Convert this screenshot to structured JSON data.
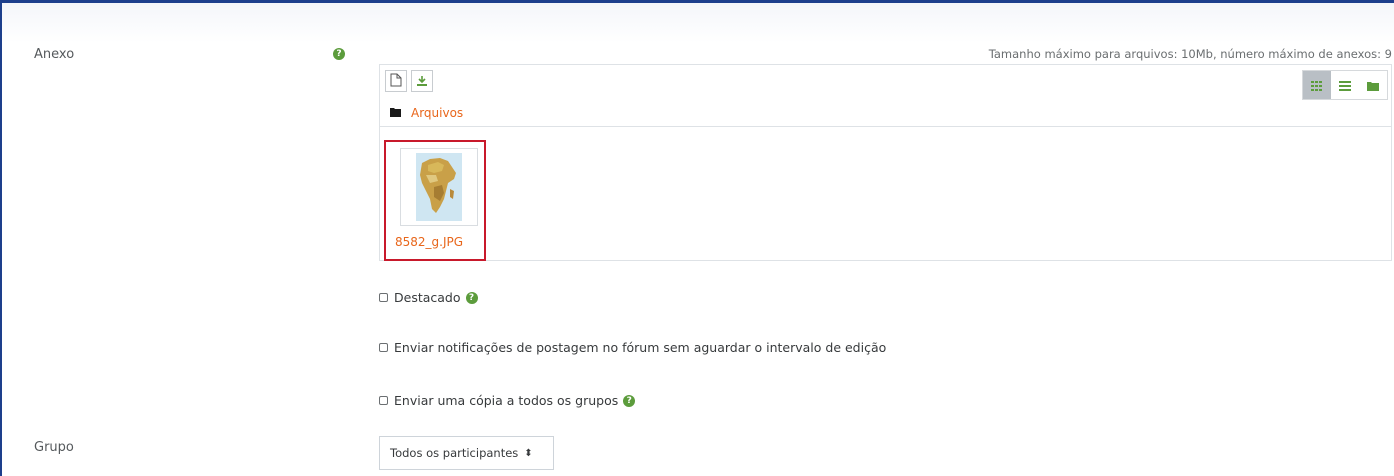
{
  "attachment": {
    "label": "Anexo",
    "max_info": "Tamanho máximo para arquivos: 10Mb, número máximo de anexos: 9",
    "toolbar": {
      "add_file_icon": "file-icon",
      "download_icon": "download-icon",
      "views": [
        "grid-view-icon",
        "list-view-icon",
        "folder-view-icon"
      ],
      "active_view": "grid-view-icon"
    },
    "breadcrumb": {
      "folder_label": "Arquivos"
    },
    "files": [
      {
        "name": "8582_g.JPG"
      }
    ]
  },
  "options": {
    "pinned": "Destacado",
    "notify": "Enviar notificações de postagem no fórum sem aguardar o intervalo de edição",
    "copy_groups": "Enviar uma cópia a todos os grupos"
  },
  "group": {
    "label": "Grupo",
    "selected": "Todos os participantes"
  },
  "colors": {
    "accent": "#e8661b",
    "help": "#5c9c3c",
    "highlight": "#c8192b",
    "border_frame": "#1d3f8c"
  }
}
